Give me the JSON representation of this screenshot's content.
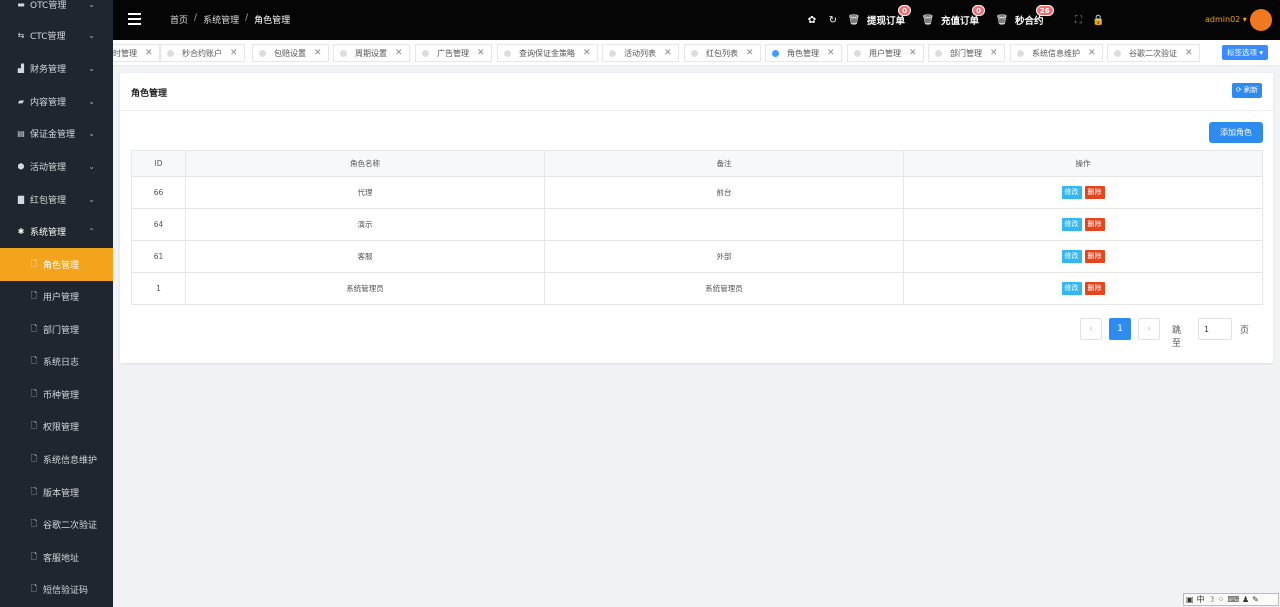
{
  "sidebar": {
    "items": [
      {
        "label": "OTC管理",
        "icon": "wallet-icon"
      },
      {
        "label": "CTC管理",
        "icon": "exchange-icon"
      },
      {
        "label": "财务管理",
        "icon": "chart-icon"
      },
      {
        "label": "内容管理",
        "icon": "folder-icon"
      },
      {
        "label": "保证金管理",
        "icon": "money-icon"
      },
      {
        "label": "活动管理",
        "icon": "cube-icon"
      },
      {
        "label": "红包管理",
        "icon": "gift-icon"
      },
      {
        "label": "系统管理",
        "icon": "gear-icon"
      }
    ],
    "sub_items": [
      {
        "label": "角色管理"
      },
      {
        "label": "用户管理"
      },
      {
        "label": "部门管理"
      },
      {
        "label": "系统日志"
      },
      {
        "label": "币种管理"
      },
      {
        "label": "权限管理"
      },
      {
        "label": "系统信息维护"
      },
      {
        "label": "版本管理"
      },
      {
        "label": "谷歌二次验证"
      },
      {
        "label": "客服地址"
      },
      {
        "label": "短信验证码"
      }
    ]
  },
  "header": {
    "breadcrumb": [
      "首页",
      "系统管理",
      "角色管理"
    ],
    "withdraw_label": "提现订单",
    "withdraw_count": "0",
    "recharge_label": "充值订单",
    "recharge_count": "0",
    "contract_label": "秒合约",
    "contract_count": "26",
    "username": "admin02 ▾"
  },
  "tabs": [
    {
      "label": "时管理"
    },
    {
      "label": "秒合约账户"
    },
    {
      "label": "包赔设置"
    },
    {
      "label": "周期设置"
    },
    {
      "label": "广告管理"
    },
    {
      "label": "查询保证金策略"
    },
    {
      "label": "活动列表"
    },
    {
      "label": "红包列表"
    },
    {
      "label": "角色管理",
      "active": true
    },
    {
      "label": "用户管理"
    },
    {
      "label": "部门管理"
    },
    {
      "label": "系统信息维护"
    },
    {
      "label": "谷歌二次验证"
    }
  ],
  "tab_select_label": "标签选项 ▾",
  "main": {
    "title": "角色管理",
    "refresh_label": "⟳ 刷新",
    "add_label": "添加角色",
    "columns": [
      "ID",
      "角色名称",
      "备注",
      "操作"
    ],
    "rows": [
      {
        "id": "66",
        "name": "代理",
        "remark": "前台"
      },
      {
        "id": "64",
        "name": "演示",
        "remark": ""
      },
      {
        "id": "61",
        "name": "客服",
        "remark": "外部"
      },
      {
        "id": "1",
        "name": "系统管理员",
        "remark": "系统管理员"
      }
    ],
    "edit_label": "修改",
    "delete_label": "删除"
  },
  "pagination": {
    "prev": "‹",
    "current": "1",
    "next": "›",
    "goto_label": "跳至",
    "goto_value": "1",
    "page_suffix": "页"
  },
  "ime": {
    "label": "中"
  }
}
